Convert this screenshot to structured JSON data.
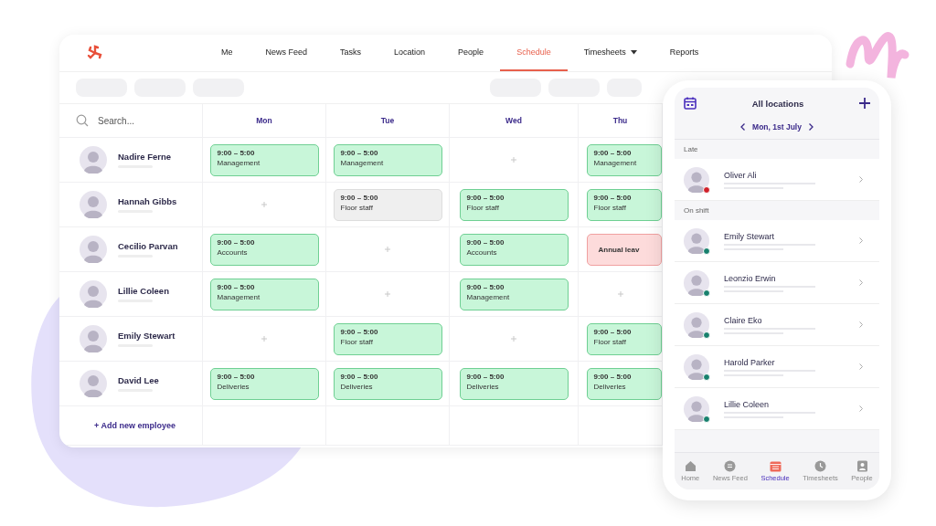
{
  "nav": {
    "items": [
      {
        "label": "Me",
        "selected": false,
        "has_menu": false
      },
      {
        "label": "News Feed",
        "selected": false,
        "has_menu": false
      },
      {
        "label": "Tasks",
        "selected": false,
        "has_menu": false
      },
      {
        "label": "Location",
        "selected": false,
        "has_menu": false
      },
      {
        "label": "People",
        "selected": false,
        "has_menu": false
      },
      {
        "label": "Schedule",
        "selected": true,
        "has_menu": false
      },
      {
        "label": "Timesheets",
        "selected": false,
        "has_menu": true
      },
      {
        "label": "Reports",
        "selected": false,
        "has_menu": false
      }
    ]
  },
  "schedule": {
    "search": {
      "placeholder": "Search..."
    },
    "days": [
      "Mon",
      "Tue",
      "Wed",
      "Thu"
    ],
    "employees": [
      {
        "name": "Nadire Ferne",
        "shifts": [
          {
            "kind": "shift",
            "time": "9:00 – 5:00",
            "role": "Management"
          },
          {
            "kind": "shift",
            "time": "9:00 – 5:00",
            "role": "Management"
          },
          {
            "kind": "empty"
          },
          {
            "kind": "shift",
            "time": "9:00 – 5:00",
            "role": "Management"
          }
        ]
      },
      {
        "name": "Hannah Gibbs",
        "shifts": [
          {
            "kind": "empty"
          },
          {
            "kind": "pending",
            "time": "9:00 – 5:00",
            "role": "Floor staff"
          },
          {
            "kind": "shift",
            "time": "9:00 – 5:00",
            "role": "Floor staff"
          },
          {
            "kind": "shift",
            "time": "9:00 – 5:00",
            "role": "Floor staff"
          }
        ]
      },
      {
        "name": "Cecilio Parvan",
        "shifts": [
          {
            "kind": "shift",
            "time": "9:00 – 5:00",
            "role": "Accounts"
          },
          {
            "kind": "empty"
          },
          {
            "kind": "shift",
            "time": "9:00 – 5:00",
            "role": "Accounts"
          },
          {
            "kind": "leave",
            "label": "Annual leav"
          }
        ]
      },
      {
        "name": "Lillie Coleen",
        "shifts": [
          {
            "kind": "shift",
            "time": "9:00 – 5:00",
            "role": "Management"
          },
          {
            "kind": "empty"
          },
          {
            "kind": "shift",
            "time": "9:00 – 5:00",
            "role": "Management"
          },
          {
            "kind": "empty"
          }
        ]
      },
      {
        "name": "Emily Stewart",
        "shifts": [
          {
            "kind": "empty"
          },
          {
            "kind": "shift",
            "time": "9:00 – 5:00",
            "role": "Floor staff"
          },
          {
            "kind": "empty"
          },
          {
            "kind": "shift",
            "time": "9:00 – 5:00",
            "role": "Floor staff"
          }
        ]
      },
      {
        "name": "David Lee",
        "shifts": [
          {
            "kind": "shift",
            "time": "9:00 – 5:00",
            "role": "Deliveries"
          },
          {
            "kind": "shift",
            "time": "9:00 – 5:00",
            "role": "Deliveries"
          },
          {
            "kind": "shift",
            "time": "9:00 – 5:00",
            "role": "Deliveries"
          },
          {
            "kind": "shift",
            "time": "9:00 – 5:00",
            "role": "Deliveries"
          }
        ]
      }
    ],
    "add_label": "+ Add new employee"
  },
  "phone": {
    "title": "All locations",
    "date": "Mon, 1st July",
    "sections": [
      {
        "title": "Late",
        "people": [
          {
            "name": "Oliver Ali",
            "color": "#d0202a"
          }
        ]
      },
      {
        "title": "On shift",
        "people": [
          {
            "name": "Emily Stewart",
            "color": "#17806d"
          },
          {
            "name": "Leonzio Erwin",
            "color": "#17806d"
          },
          {
            "name": "Claire Eko",
            "color": "#17806d"
          },
          {
            "name": "Harold Parker",
            "color": "#17806d"
          },
          {
            "name": "Lillie Coleen",
            "color": "#17806d"
          }
        ]
      }
    ],
    "tabs": [
      {
        "label": "Home",
        "selected": false
      },
      {
        "label": "News Feed",
        "selected": false
      },
      {
        "label": "Schedule",
        "selected": true
      },
      {
        "label": "Timesheets",
        "selected": false
      },
      {
        "label": "People",
        "selected": false
      }
    ]
  }
}
